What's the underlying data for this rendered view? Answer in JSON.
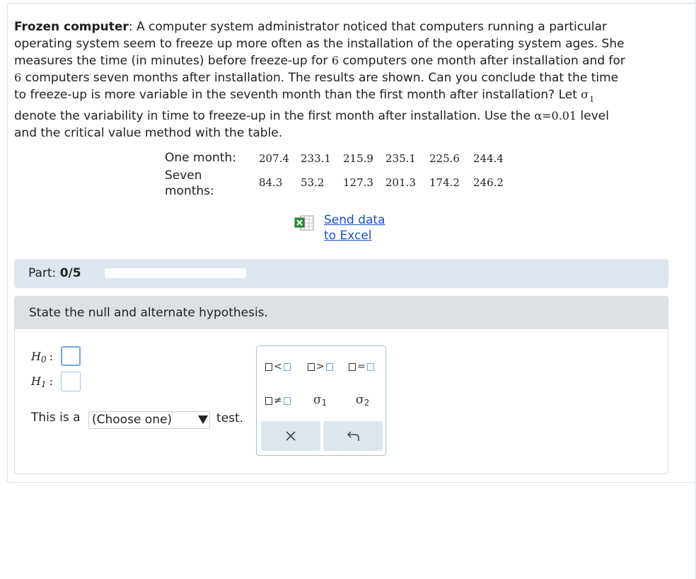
{
  "problem": {
    "title": "Frozen computer",
    "line1": ": A computer system administrator noticed that computers running a particular",
    "line2": "operating system seem to freeze up more often as the installation of the operating system ages. She",
    "line3a": "measures the time (in minutes) before freeze-up for ",
    "n1": "6",
    "line3b": " computers one month after installation and for",
    "n2": "6",
    "line4": " computers seven months after installation. The results are shown. Can you conclude that the time",
    "line5": "to freeze-up is more variable in the seventh month than the first month after installation? Let ",
    "sigma": "σ",
    "sigma_sub": "1",
    "line6a": "denote the variability in time to freeze-up in the first month after installation. Use the ",
    "alpha": "α=0.01",
    "line6b": " level",
    "line7": "and the critical value method with the table."
  },
  "data_table": {
    "row1_label": "One month:",
    "row2_label_a": "Seven",
    "row2_label_b": "months:",
    "one_month": [
      "207.4",
      "233.1",
      "215.9",
      "235.1",
      "225.6",
      "244.4"
    ],
    "seven_months": [
      "84.3",
      "53.2",
      "127.3",
      "201.3",
      "174.2",
      "246.2"
    ]
  },
  "excel": {
    "link_line1": "Send data",
    "link_line2": "to Excel"
  },
  "part": {
    "label": "Part: ",
    "progress": "0/5",
    "progress_fraction": 0.0
  },
  "question": {
    "header": "State the null and alternate hypothesis.",
    "h0_label": "H",
    "h0_sub": "0",
    "h1_label": "H",
    "h1_sub": "1",
    "colon": ":",
    "choose_prefix": "This is a",
    "select_value": "(Choose one)",
    "choose_suffix": "test."
  },
  "palette": {
    "lt": "<",
    "gt": ">",
    "eq": "=",
    "ne": "≠",
    "sigma1": "σ",
    "sigma1_sub": "1",
    "sigma2": "σ",
    "sigma2_sub": "2",
    "clear_icon": "x-icon",
    "undo_icon": "undo-icon"
  },
  "colors": {
    "link": "#1a4fd1",
    "part_bar": "#dde6ee",
    "answer_border": "#6fa7d8"
  }
}
